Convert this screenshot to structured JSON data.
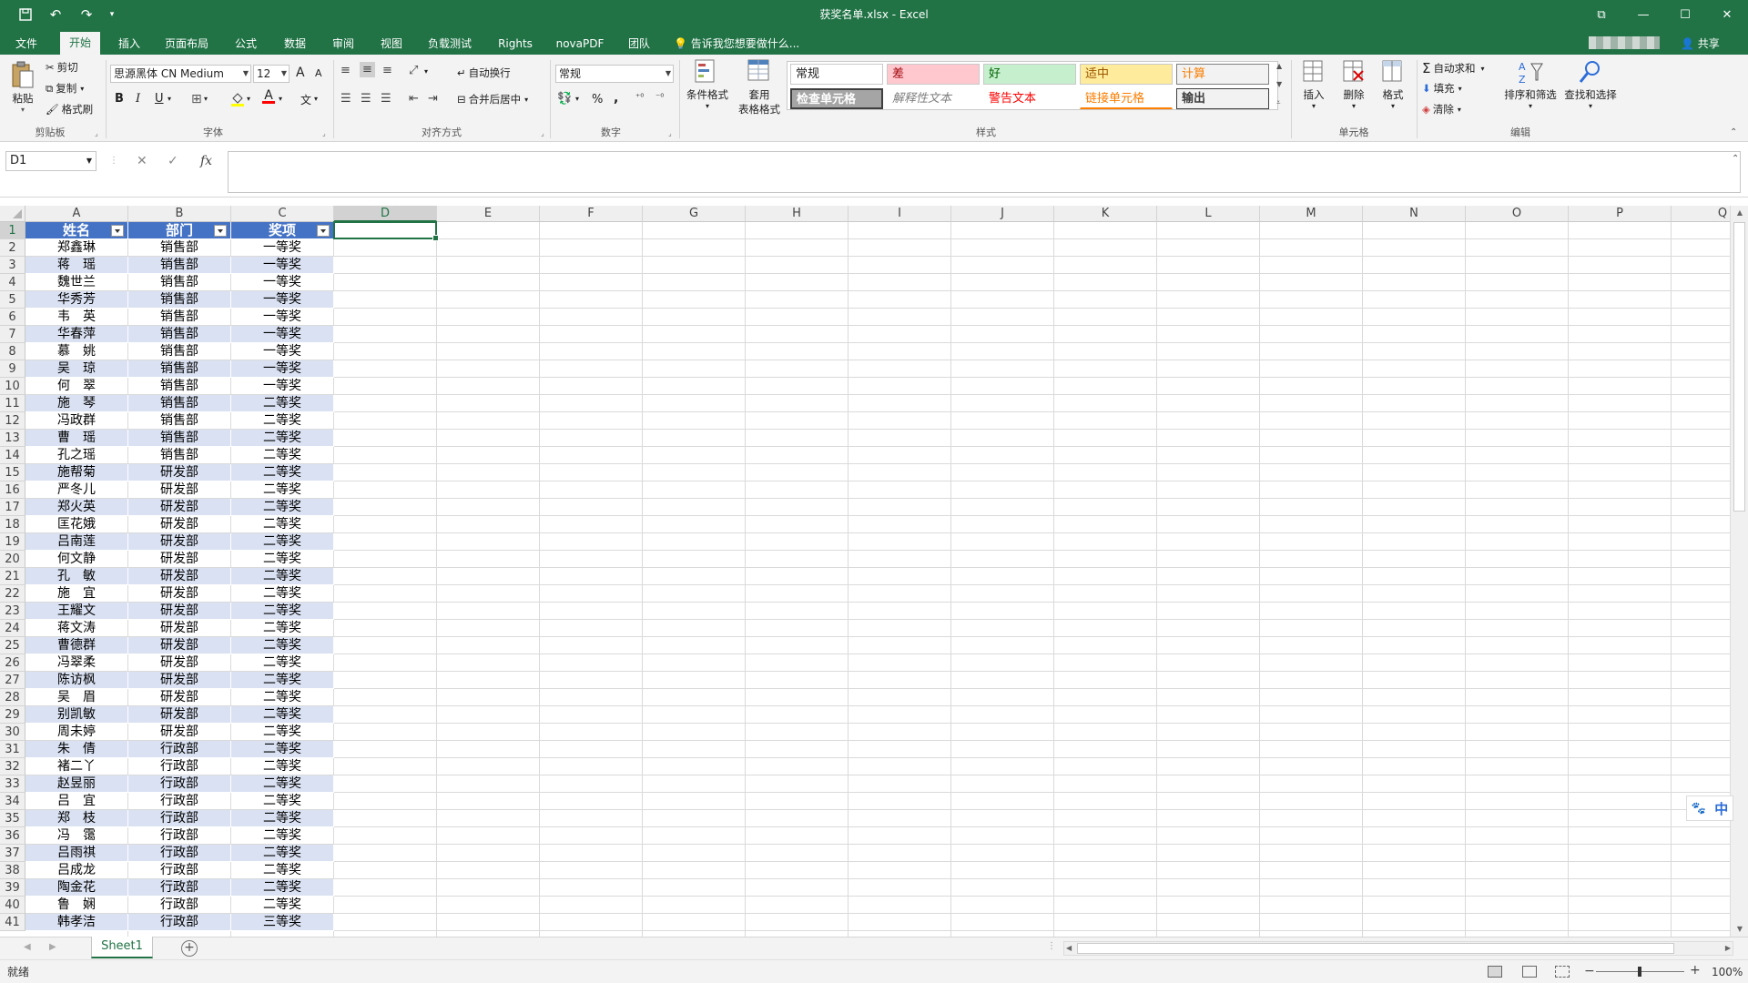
{
  "window": {
    "title": "获奖名单.xlsx - Excel",
    "restore_label": "⧉",
    "minimize_label": "—",
    "maximize_label": "☐",
    "close_label": "✕"
  },
  "tabs": [
    {
      "label": "文件"
    },
    {
      "label": "开始"
    },
    {
      "label": "插入"
    },
    {
      "label": "页面布局"
    },
    {
      "label": "公式"
    },
    {
      "label": "数据"
    },
    {
      "label": "审阅"
    },
    {
      "label": "视图"
    },
    {
      "label": "负载测试"
    },
    {
      "label": "Rights"
    },
    {
      "label": "novaPDF"
    },
    {
      "label": "团队"
    }
  ],
  "tell_me": "告诉我您想要做什么...",
  "share_label": "共享",
  "ribbon": {
    "clipboard": {
      "paste": "粘贴",
      "cut": "剪切",
      "copy": "复制",
      "format_painter": "格式刷",
      "group": "剪贴板"
    },
    "font": {
      "family": "思源黑体 CN Medium",
      "size": "12",
      "bold": "B",
      "italic": "I",
      "underline": "U",
      "group": "字体",
      "grow": "A",
      "shrink": "A",
      "color_letter": "A"
    },
    "alignment": {
      "wrap": "自动换行",
      "merge": "合并后居中",
      "group": "对齐方式"
    },
    "number": {
      "format": "常规",
      "percent": "%",
      "comma": ",",
      "group": "数字"
    },
    "styles": {
      "conditional": "条件格式",
      "table_format_1": "套用",
      "table_format_2": "表格格式",
      "cells": [
        {
          "label": "常规"
        },
        {
          "label": "差"
        },
        {
          "label": "好"
        },
        {
          "label": "适中"
        },
        {
          "label": "计算"
        },
        {
          "label": "检查单元格"
        },
        {
          "label": "解释性文本"
        },
        {
          "label": "警告文本"
        },
        {
          "label": "链接单元格"
        },
        {
          "label": "输出"
        }
      ],
      "group": "样式"
    },
    "cells_group": {
      "insert": "插入",
      "delete": "删除",
      "format": "格式",
      "group": "单元格"
    },
    "editing": {
      "autosum": "自动求和",
      "fill": "填充",
      "clear": "清除",
      "sort": "排序和筛选",
      "find": "查找和选择",
      "group": "编辑"
    }
  },
  "formula_bar": {
    "name_box": "D1",
    "cancel": "✕",
    "enter": "✓",
    "fx": "fx",
    "value": ""
  },
  "columns": [
    "A",
    "B",
    "C",
    "D",
    "E",
    "F",
    "G",
    "H",
    "I",
    "J",
    "K",
    "L",
    "M",
    "N",
    "O",
    "P",
    "Q"
  ],
  "selected_column": "D",
  "selected_row": 1,
  "table": {
    "headers": [
      "姓名",
      "部门",
      "奖项"
    ],
    "rows": [
      [
        "郑鑫琳",
        "销售部",
        "一等奖"
      ],
      [
        "蒋　瑶",
        "销售部",
        "一等奖"
      ],
      [
        "魏世兰",
        "销售部",
        "一等奖"
      ],
      [
        "华秀芳",
        "销售部",
        "一等奖"
      ],
      [
        "韦　英",
        "销售部",
        "一等奖"
      ],
      [
        "华春萍",
        "销售部",
        "一等奖"
      ],
      [
        "慕　姚",
        "销售部",
        "一等奖"
      ],
      [
        "吴　琼",
        "销售部",
        "一等奖"
      ],
      [
        "何　翠",
        "销售部",
        "一等奖"
      ],
      [
        "施　琴",
        "销售部",
        "二等奖"
      ],
      [
        "冯政群",
        "销售部",
        "二等奖"
      ],
      [
        "曹　瑶",
        "销售部",
        "二等奖"
      ],
      [
        "孔之瑶",
        "销售部",
        "二等奖"
      ],
      [
        "施帮菊",
        "研发部",
        "二等奖"
      ],
      [
        "严冬儿",
        "研发部",
        "二等奖"
      ],
      [
        "郑火英",
        "研发部",
        "二等奖"
      ],
      [
        "匡花娥",
        "研发部",
        "二等奖"
      ],
      [
        "吕南莲",
        "研发部",
        "二等奖"
      ],
      [
        "何文静",
        "研发部",
        "二等奖"
      ],
      [
        "孔　敏",
        "研发部",
        "二等奖"
      ],
      [
        "施　宜",
        "研发部",
        "二等奖"
      ],
      [
        "王耀文",
        "研发部",
        "二等奖"
      ],
      [
        "蒋文涛",
        "研发部",
        "二等奖"
      ],
      [
        "曹德群",
        "研发部",
        "二等奖"
      ],
      [
        "冯翠柔",
        "研发部",
        "二等奖"
      ],
      [
        "陈访枫",
        "研发部",
        "二等奖"
      ],
      [
        "吴　眉",
        "研发部",
        "二等奖"
      ],
      [
        "别凯敏",
        "研发部",
        "二等奖"
      ],
      [
        "周未婷",
        "研发部",
        "二等奖"
      ],
      [
        "朱　倩",
        "行政部",
        "二等奖"
      ],
      [
        "褚二丫",
        "行政部",
        "二等奖"
      ],
      [
        "赵昱丽",
        "行政部",
        "二等奖"
      ],
      [
        "吕　宜",
        "行政部",
        "二等奖"
      ],
      [
        "郑　枝",
        "行政部",
        "二等奖"
      ],
      [
        "冯　霭",
        "行政部",
        "二等奖"
      ],
      [
        "吕雨祺",
        "行政部",
        "二等奖"
      ],
      [
        "吕成龙",
        "行政部",
        "二等奖"
      ],
      [
        "陶金花",
        "行政部",
        "二等奖"
      ],
      [
        "鲁　娴",
        "行政部",
        "二等奖"
      ],
      [
        "韩孝洁",
        "行政部",
        "三等奖"
      ]
    ]
  },
  "sheet_tab": "Sheet1",
  "add_sheet": "+",
  "status": "就绪",
  "zoom": "100%",
  "ime": {
    "paw": "🐾",
    "mode": "中"
  }
}
